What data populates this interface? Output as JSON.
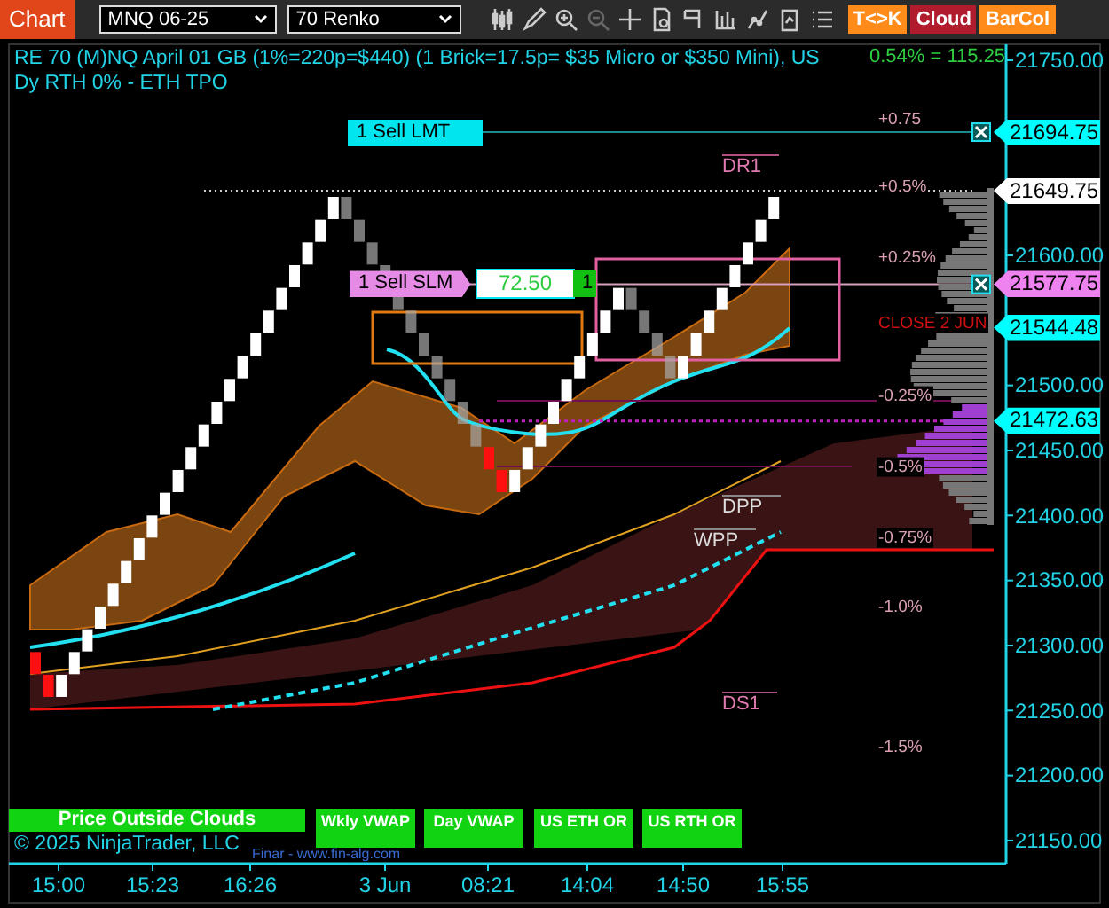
{
  "toolbar": {
    "title": "Chart",
    "instrument": "MNQ 06-25",
    "period": "70 Renko",
    "buttons": [
      {
        "label": "T<>K",
        "color": "#ff8c1a"
      },
      {
        "label": "Cloud",
        "color": "#b01c2e"
      },
      {
        "label": "BarCol",
        "color": "#ff8c1a"
      }
    ]
  },
  "chart": {
    "title": "RE 70 (M)NQ April 01 GB (1%=220p=$440) (1 Brick=17.5p= $35 Micro or $350 Mini), US Dy RTH 0% - ETH TPO",
    "change": "0.54% = 115.25",
    "orders": [
      {
        "label": "1 Sell LMT",
        "kind": "limit"
      },
      {
        "label": "1 Sell SLM",
        "kind": "stop",
        "price": "72.50",
        "quantity": "1"
      }
    ],
    "percent_levels": [
      "+0.75",
      "+0.5%",
      "+0.25%",
      "CLOSE 2 JUN",
      "-0.25%",
      "-0.5%",
      "-0.75%",
      "-1.0%",
      "-1.5%"
    ],
    "pivots": [
      "DR1",
      "DPP",
      "WPP",
      "DS1"
    ],
    "indicators": [
      "Price Outside Clouds",
      "Wkly VWAP",
      "Day VWAP",
      "US ETH OR",
      "US RTH OR"
    ],
    "copyright": "© 2025 NinjaTrader, LLC",
    "credit": "Finar - www.fin-alg.com"
  },
  "price_axis": {
    "ticks": [
      "21750.00",
      "21600.00",
      "21500.00",
      "21450.00",
      "21400.00",
      "21350.00",
      "21300.00",
      "21250.00",
      "21200.00",
      "21150.00"
    ],
    "markers": [
      {
        "label": "21694.75",
        "color": "#00ffff"
      },
      {
        "label": "21649.75",
        "color": "#ffffff"
      },
      {
        "label": "21577.75",
        "color": "#ee82ee"
      },
      {
        "label": "21544.48",
        "color": "#00ffff"
      },
      {
        "label": "21472.63",
        "color": "#00ffff"
      }
    ]
  },
  "time_axis": {
    "labels": [
      "15:00",
      "15:23",
      "16:26",
      "3 Jun",
      "08:21",
      "14:04",
      "14:50",
      "15:55"
    ]
  }
}
